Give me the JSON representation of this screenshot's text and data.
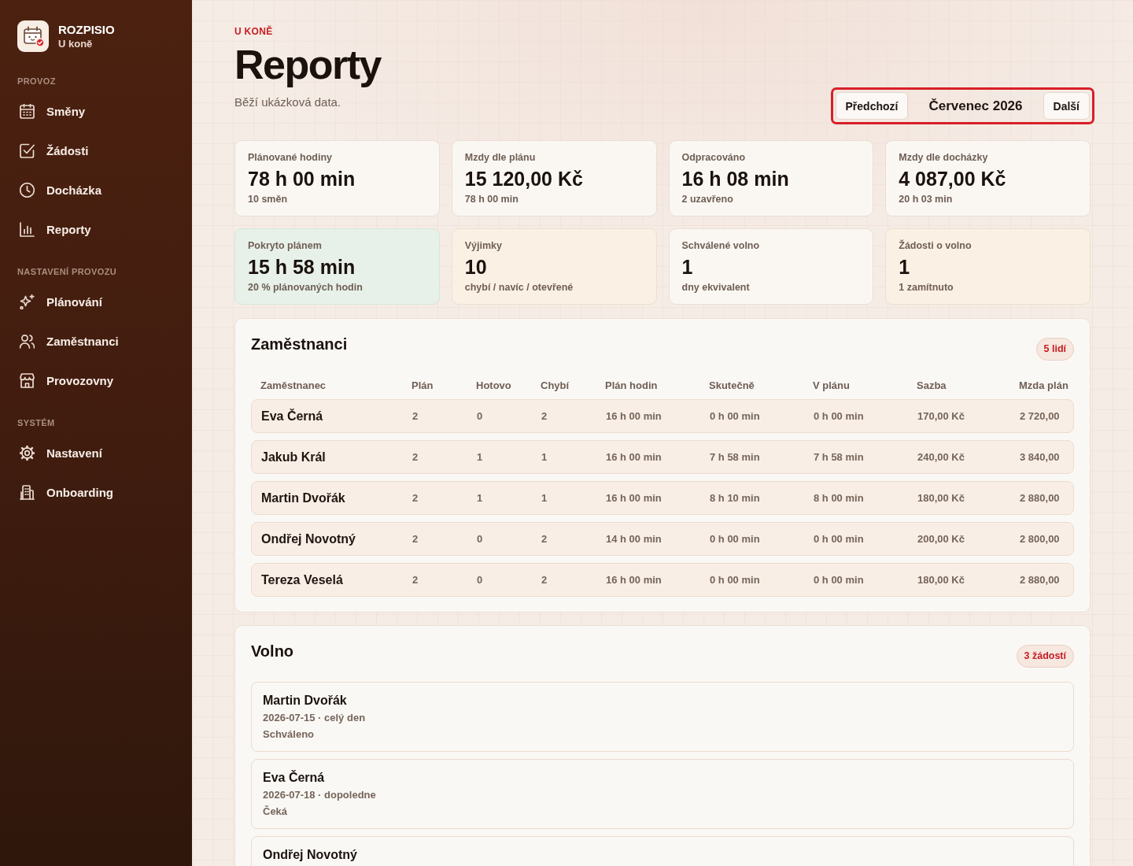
{
  "sidebar": {
    "brand": {
      "name": "ROZPISIO",
      "subtitle": "U koně"
    },
    "sections": [
      {
        "title": "PROVOZ",
        "items": [
          {
            "label": "Směny",
            "kind": "shifts"
          },
          {
            "label": "Žádosti",
            "kind": "requests"
          },
          {
            "label": "Docházka",
            "kind": "attendance"
          },
          {
            "label": "Reporty",
            "kind": "reports"
          }
        ]
      },
      {
        "title": "NASTAVENÍ PROVOZU",
        "items": [
          {
            "label": "Plánování",
            "kind": "planning"
          },
          {
            "label": "Zaměstnanci",
            "kind": "employees"
          },
          {
            "label": "Provozovny",
            "kind": "locations"
          }
        ]
      },
      {
        "title": "SYSTÉM",
        "items": [
          {
            "label": "Nastavení",
            "kind": "settings"
          },
          {
            "label": "Onboarding",
            "kind": "onboarding"
          }
        ]
      }
    ]
  },
  "header": {
    "eyebrow": "U KONĚ",
    "title": "Reporty",
    "subtitle": "Běží ukázková data."
  },
  "month_nav": {
    "highlighted": true,
    "previous": "Předchozí",
    "month": "Červenec 2026",
    "next": "Další"
  },
  "stats": [
    {
      "label": "Plánované hodiny",
      "value": "78 h 00 min",
      "note": "10 směn",
      "kind": "plain"
    },
    {
      "label": "Mzdy dle plánu",
      "value": "15 120,00 Kč",
      "note": "78 h 00 min",
      "kind": "plain"
    },
    {
      "label": "Odpracováno",
      "value": "16 h 08 min",
      "note": "2 uzavřeno",
      "kind": "plain"
    },
    {
      "label": "Mzdy dle docházky",
      "value": "4 087,00 Kč",
      "note": "20 h 03 min",
      "kind": "plain"
    },
    {
      "label": "Pokryto plánem",
      "value": "15 h 58 min",
      "note": "20 % plánovaných hodin",
      "kind": "positive"
    },
    {
      "label": "Výjimky",
      "value": "10",
      "note": "chybí / navíc / otevřené",
      "kind": "attention"
    },
    {
      "label": "Schválené volno",
      "value": "1",
      "note": "dny ekvivalent",
      "kind": "plain"
    },
    {
      "label": "Žádosti o volno",
      "value": "1",
      "note": "1 zamítnuto",
      "kind": "attention"
    }
  ],
  "employees": {
    "title": "Zaměstnanci",
    "badge": "5 lidí",
    "columns": [
      "Zaměstnanec",
      "Plán",
      "Hotovo",
      "Chybí",
      "Plán hodin",
      "Skutečně",
      "V plánu",
      "Sazba",
      "Mzda plán"
    ],
    "rows": [
      [
        "Eva Černá",
        "2",
        "0",
        "2",
        "16 h 00 min",
        "0 h 00 min",
        "0 h 00 min",
        "170,00 Kč",
        "2 720,00"
      ],
      [
        "Jakub Král",
        "2",
        "1",
        "1",
        "16 h 00 min",
        "7 h 58 min",
        "7 h 58 min",
        "240,00 Kč",
        "3 840,00"
      ],
      [
        "Martin Dvořák",
        "2",
        "1",
        "1",
        "16 h 00 min",
        "8 h 10 min",
        "8 h 00 min",
        "180,00 Kč",
        "2 880,00"
      ],
      [
        "Ondřej Novotný",
        "2",
        "0",
        "2",
        "14 h 00 min",
        "0 h 00 min",
        "0 h 00 min",
        "200,00 Kč",
        "2 800,00"
      ],
      [
        "Tereza Veselá",
        "2",
        "0",
        "2",
        "16 h 00 min",
        "0 h 00 min",
        "0 h 00 min",
        "180,00 Kč",
        "2 880,00"
      ]
    ]
  },
  "leave": {
    "title": "Volno",
    "badge": "3 žádostí",
    "requests": [
      {
        "name": "Martin Dvořák",
        "detail": "2026-07-15 · celý den",
        "status": "Schváleno"
      },
      {
        "name": "Eva Černá",
        "detail": "2026-07-18 · dopoledne",
        "status": "Čeká"
      },
      {
        "name": "Ondřej Novotný"
      }
    ]
  }
}
